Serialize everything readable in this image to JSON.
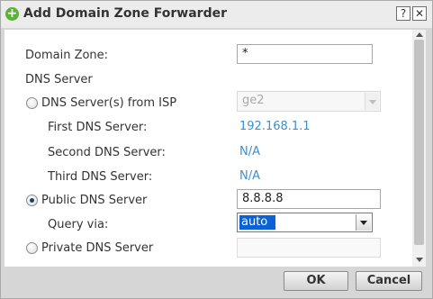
{
  "dialog": {
    "title": "Add Domain Zone Forwarder",
    "help_glyph": "?",
    "close_glyph": "✕",
    "title_icon_glyph": "+"
  },
  "form": {
    "domain_zone_label": "Domain Zone:",
    "domain_zone_value": "*",
    "dns_server_heading": "DNS Server",
    "isp_option_label": "DNS Server(s) from ISP",
    "isp_interface_value": "ge2",
    "first_dns_label": "First DNS Server:",
    "first_dns_value": "192.168.1.1",
    "second_dns_label": "Second DNS Server:",
    "second_dns_value": "N/A",
    "third_dns_label": "Third DNS Server:",
    "third_dns_value": "N/A",
    "public_option_label": "Public DNS Server",
    "public_dns_value": "8.8.8.8",
    "query_via_label": "Query via:",
    "query_via_value": "auto",
    "private_option_label": "Private DNS Server",
    "private_dns_value": ""
  },
  "selection": {
    "dns_source": "Public DNS Server"
  },
  "buttons": {
    "ok": "OK",
    "cancel": "Cancel"
  },
  "colors": {
    "link_value": "#3b8fd3",
    "add_icon": "#5db13b",
    "select_highlight": "#0a62d6"
  },
  "icons": [
    "add-icon",
    "help-icon",
    "close-icon",
    "chevron-down-icon",
    "radio-icon"
  ]
}
